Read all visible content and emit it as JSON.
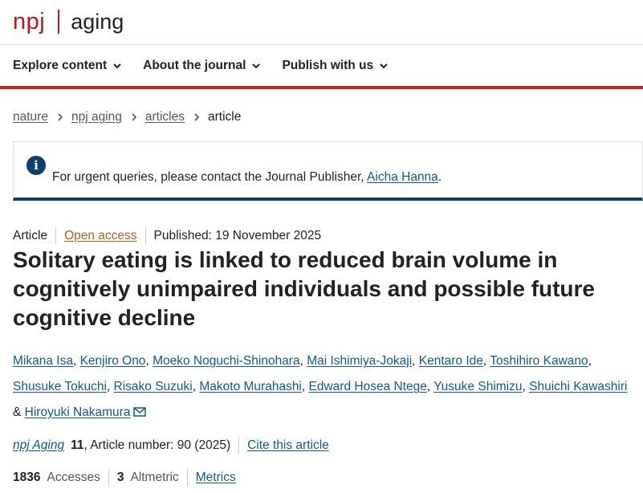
{
  "header": {
    "logo_npj": "npj",
    "logo_journal": "aging"
  },
  "nav": {
    "items": [
      {
        "label": "Explore content"
      },
      {
        "label": "About the journal"
      },
      {
        "label": "Publish with us"
      }
    ]
  },
  "breadcrumb": {
    "items": [
      "nature",
      "npj aging",
      "articles"
    ],
    "current": "article"
  },
  "alert": {
    "text_before": "For urgent queries, please contact the Journal Publisher, ",
    "link": "Aicha Hanna",
    "text_after": "."
  },
  "article": {
    "type": "Article",
    "open_access": "Open access",
    "published": "Published: 19 November 2025",
    "title": "Solitary eating is linked to reduced brain volume in cognitively unimpaired individuals and possible future cognitive decline"
  },
  "authors": [
    "Mikana Isa",
    "Kenjiro Ono",
    "Moeko Noguchi-Shinohara",
    "Mai Ishimiya-Jokaji",
    "Kentaro Ide",
    "Toshihiro Kawano",
    "Shusuke Tokuchi",
    "Risako Suzuki",
    "Makoto Murahashi",
    "Edward Hosea Ntege",
    "Yusuke Shimizu",
    "Shuichi Kawashiri",
    "Hiroyuki Nakamura"
  ],
  "citation": {
    "journal": "npj Aging",
    "volume": "11",
    "article_number": ", Article number: 90 (2025)",
    "cite_link": "Cite this article"
  },
  "metrics": {
    "accesses_value": "1836",
    "accesses_label": "Accesses",
    "altmetric_value": "3",
    "altmetric_label": "Altmetric",
    "link": "Metrics"
  },
  "colors": {
    "brand_red": "#c0171f",
    "link_blue": "#0e5a8a",
    "alert_navy": "#0e3e6e",
    "open_access": "#b15e1c"
  }
}
